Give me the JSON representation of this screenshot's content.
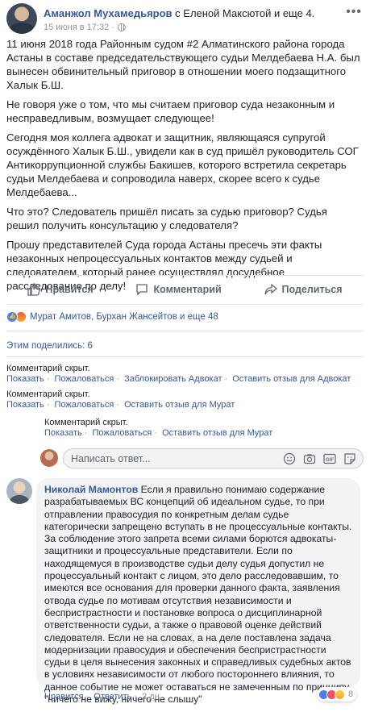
{
  "post": {
    "author": "Аманжол Мухамедьяров",
    "with_text": "с Еленой Максютой и еще 4.",
    "timestamp": "15 июня в 17:32 ·",
    "paragraphs": [
      "11 июня 2018 года Районным судом #2 Алматинского района города Астаны в составе председательствующего судьи Мелдебаева Н.А. был вынесен обвинительный приговор в отношении моего подзащитного Халык Б.Ш.",
      "Не говоря уже о том, что мы считаем приговор суда незаконным и несправедливым, возмущает следующее!",
      "Сегодня моя коллега адвокат и защитник, являющаяся супругой осуждённого Халык Б.Ш., увидели как в суд пришёл руководитель СОГ Антикоррупционной службы Бакишев, которого встретила секретарь судьи Мелдебаева и сопроводила наверх, скорее всего к судье Мелдебаева...",
      "Что это? Следователь пришёл писать за судью приговор? Судья решил получить консультацию у следователя?",
      "Прошу представителей Суда города Астаны пресечь эти факты незаконных непроцессуальных контактов между судьей и следователем, который ранее осуществлял досудебное расследование по делу!"
    ]
  },
  "actions": {
    "like": "Нравится",
    "comment": "Комментарий",
    "share": "Поделиться"
  },
  "reactions_text": "Мурат Амитов, Бурхан Жансейтов и еще 48",
  "shares_text": "Этим поделились: 6",
  "hidden_comments": [
    {
      "title": "Комментарий скрыт.",
      "links": [
        "Показать",
        "Пожаловаться",
        "Заблокировать Адвокат",
        "Оставить отзыв для Адвокат"
      ]
    },
    {
      "title": "Комментарий скрыт.",
      "links": [
        "Показать",
        "Пожаловаться",
        "Оставить отзыв для Мурат"
      ]
    },
    {
      "title": "Комментарий скрыт.",
      "links": [
        "Показать",
        "Пожаловаться",
        "Оставить отзыв для Мурат"
      ]
    }
  ],
  "comment_input": {
    "placeholder": "Написать ответ..."
  },
  "reply": {
    "author": "Николай Мамонтов",
    "text": "Если я правильно понимаю содержание разрабатываемых ВС концепций об идеальном судье, то при отправлении правосудия по конкретным делам судье категорически запрещено вступать в не процессуальные контакты. За соблюдение этого запрета всеми силами борются адвокаты-защитники и процессуальные представители. Если по находящемуся в производстве судьи делу судья допустил не процессуальный контакт с лицом, это дело расследовавшим, то имеются все основания для проверки данного факта, заявления отвода судье по мотивам отсутствия независимости и беспристрастности и постановке вопроса о дисциплинарной ответственности судьи, а также о правовой оценке действий следователя. Если не на словах, а на деле поставлена задача модернизации правосудия и обеспечения беспристрастности судьи в целя вынесения законных и справедливых судебных актов в условиях независимости от любого постороннего влияния, то данное событие не может оставаться не замеченным по принципу \"ничего не вижу, ничего не слышу\"",
    "like": "Нравится",
    "reply_link": "Ответить",
    "time": "2 дн.",
    "reaction_count": "8"
  },
  "icons": [
    "globe-icon",
    "more-menu-icon",
    "like-icon",
    "comment-icon",
    "share-icon",
    "emoji-icon",
    "camera-icon",
    "gif-icon",
    "sticker-icon"
  ],
  "colors": {
    "link": "#385898",
    "text": "#1d2129",
    "muted": "#90949c",
    "bubble": "#f2f3f5"
  }
}
